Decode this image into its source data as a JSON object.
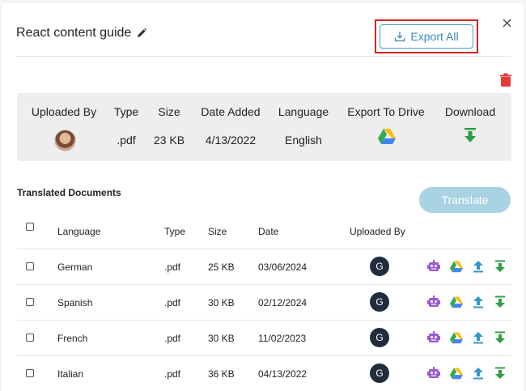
{
  "modal": {
    "title": "React content guide",
    "export_all_label": "Export All"
  },
  "info": {
    "headers": [
      "Uploaded By",
      "Type",
      "Size",
      "Date Added",
      "Language",
      "Export To Drive",
      "Download"
    ],
    "type": ".pdf",
    "size": "23 KB",
    "date_added": "4/13/2022",
    "language": "English"
  },
  "translated": {
    "section_title": "Translated Documents",
    "translate_label": "Translate",
    "columns": {
      "language": "Language",
      "type": "Type",
      "size": "Size",
      "date": "Date",
      "uploaded_by": "Uploaded By"
    },
    "rows": [
      {
        "language": "German",
        "type": ".pdf",
        "size": "25 KB",
        "date": "03/06/2024",
        "uploader_initial": "G"
      },
      {
        "language": "Spanish",
        "type": ".pdf",
        "size": "30 KB",
        "date": "02/12/2024",
        "uploader_initial": "G"
      },
      {
        "language": "French",
        "type": ".pdf",
        "size": "30 KB",
        "date": "11/02/2023",
        "uploader_initial": "G"
      },
      {
        "language": "Italian",
        "type": ".pdf",
        "size": "36 KB",
        "date": "04/13/2022",
        "uploader_initial": "G"
      }
    ]
  },
  "colors": {
    "accent": "#3a88b8",
    "highlight": "#d3241f",
    "translate_btn": "#a9d2e3",
    "download_green": "#2f9e44",
    "upload_teal": "#3497c9",
    "robot_purple": "#9b59d0",
    "trash_red": "#e53935"
  },
  "icons": [
    "close-icon",
    "edit-pencil-icon",
    "download-tray-icon",
    "trash-icon",
    "google-drive-icon",
    "download-arrow-icon",
    "robot-icon",
    "upload-arrow-icon"
  ]
}
